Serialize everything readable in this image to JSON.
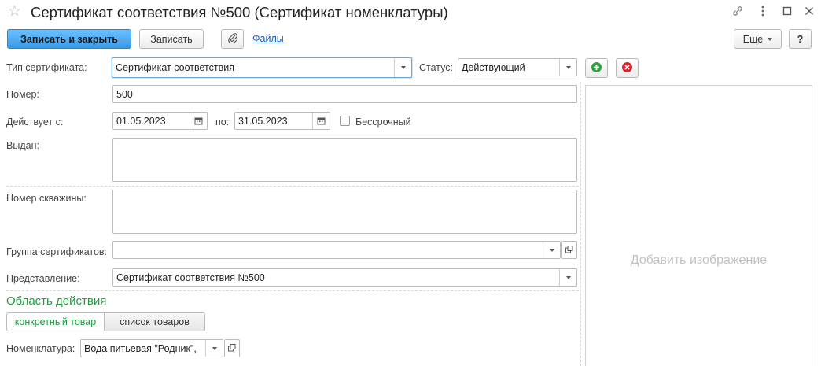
{
  "window": {
    "title": "Сертификат соответствия №500 (Сертификат номенклатуры)"
  },
  "toolbar": {
    "save_close_label": "Записать и закрыть",
    "save_label": "Записать",
    "files_label": "Файлы",
    "more_label": "Еще",
    "help_label": "?"
  },
  "form": {
    "type_label": "Тип сертификата:",
    "type_value": "Сертификат соответствия",
    "status_label": "Статус:",
    "status_value": "Действующий",
    "number_label": "Номер:",
    "number_value": "500",
    "valid_from_label": "Действует с:",
    "valid_from_value": "01.05.2023",
    "valid_to_label": "по:",
    "valid_to_value": "31.05.2023",
    "indefinite_label": "Бессрочный",
    "issued_label": "Выдан:",
    "issued_value": "",
    "well_number_label": "Номер скважины:",
    "well_number_value": "",
    "group_label": "Группа сертификатов:",
    "group_value": "",
    "presentation_label": "Представление:",
    "presentation_value": "Сертификат соответствия №500",
    "scope_title": "Область действия",
    "scope_specific_label": "конкретный товар",
    "scope_list_label": "список товаров",
    "nomenclature_label": "Номенклатура:",
    "nomenclature_value": "Вода питьевая \"Родник\","
  },
  "image": {
    "placeholder": "Добавить изображение"
  },
  "colors": {
    "primary_button": "#3b9ae6",
    "group_title": "#1f9a3f",
    "link": "#1c5bb5",
    "add_icon": "#2ea043",
    "delete_icon": "#d9262c"
  }
}
